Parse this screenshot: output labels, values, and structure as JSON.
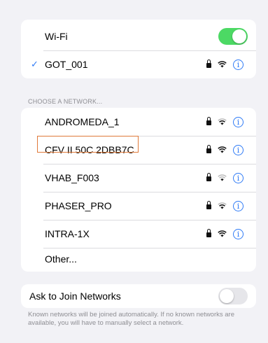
{
  "wifi": {
    "label": "Wi-Fi",
    "enabled": true,
    "accent_color": "#4cd964"
  },
  "connected": {
    "check": "✓",
    "name": "GOT_001"
  },
  "section_header": "CHOOSE A NETWORK...",
  "networks": [
    {
      "name": "ANDROMEDA_1"
    },
    {
      "name": "CFV II 50C 2DBB7C"
    },
    {
      "name": "VHAB_F003"
    },
    {
      "name": "PHASER_PRO"
    },
    {
      "name": "INTRA-1X"
    }
  ],
  "other_label": "Other...",
  "ask_join": {
    "label": "Ask to Join Networks",
    "enabled": false
  },
  "footer_text": "Known networks will be joined automatically. If no known networks are available, you will have to manually select a network.",
  "icons": {
    "lock": "lock-icon",
    "wifi": "wifi-icon",
    "info": "info-icon"
  },
  "colors": {
    "accent_blue": "#2f7bf6",
    "highlight": "#e07a3a"
  }
}
